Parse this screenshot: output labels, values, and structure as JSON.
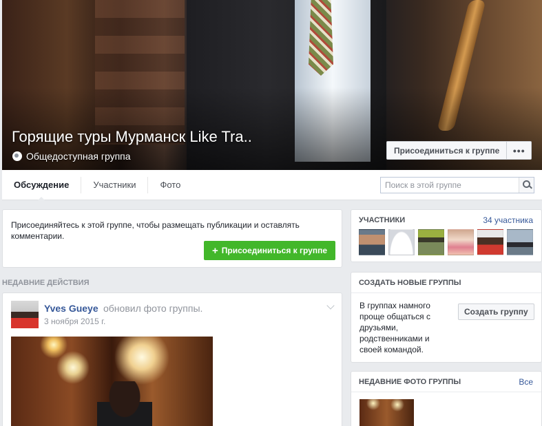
{
  "cover": {
    "title": "Горящие туры Мурманск Like Tra..",
    "privacy": "Общедоступная группа",
    "join_button": "Присоединиться к группе",
    "more_button": "•••"
  },
  "tabs": [
    {
      "label": "Обсуждение",
      "active": true
    },
    {
      "label": "Участники",
      "active": false
    },
    {
      "label": "Фото",
      "active": false
    }
  ],
  "search": {
    "placeholder": "Поиск в этой группе",
    "value": ""
  },
  "join_card": {
    "text": "Присоединяйтесь к этой группе, чтобы размещать публикации и оставлять комментарии.",
    "button": "Присоединиться к группе",
    "button_icon": "+"
  },
  "recent_activity": {
    "heading": "НЕДАВНИЕ ДЕЙСТВИЯ",
    "post": {
      "author": "Yves Gueye",
      "action": "обновил фото группы.",
      "date": "3 ноября 2015 г."
    }
  },
  "members": {
    "title": "УЧАСТНИКИ",
    "count": "34 участника",
    "faces": 6
  },
  "create_groups": {
    "title": "СОЗДАТЬ НОВЫЕ ГРУППЫ",
    "text": "В группах намного проще общаться с друзьями, родственниками и своей командой.",
    "button": "Создать группу"
  },
  "recent_photos": {
    "title": "НЕДАВНИЕ ФОТО ГРУППЫ",
    "link": "Все"
  },
  "colors": {
    "link": "#365899",
    "join_green": "#42b72a",
    "background": "#e9ebee"
  },
  "icons": [
    "globe-icon",
    "search-icon",
    "chevron-down-icon",
    "plus-icon"
  ]
}
